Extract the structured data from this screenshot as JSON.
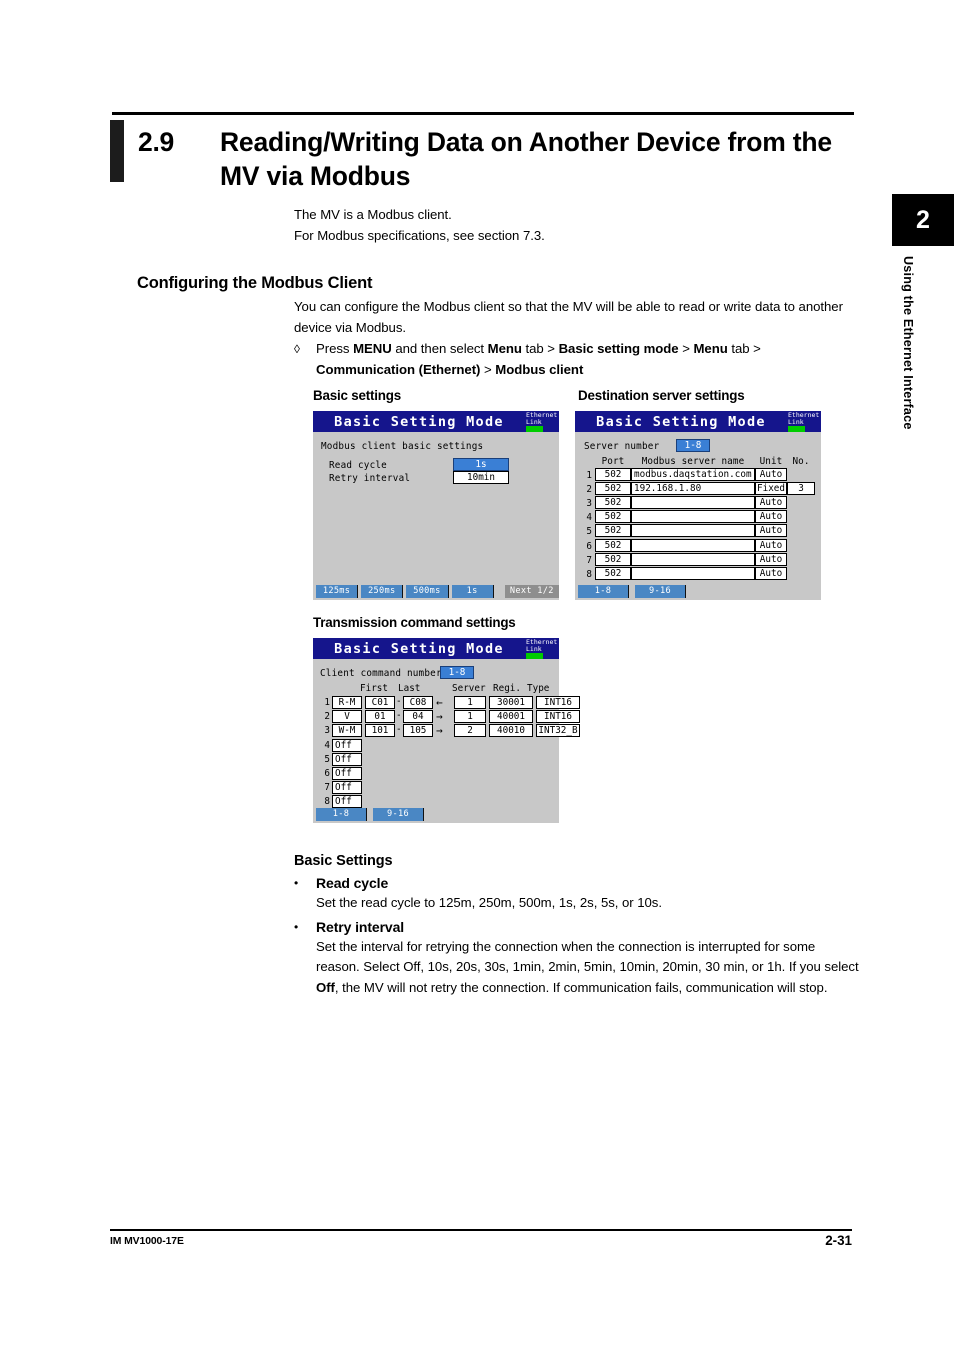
{
  "section": {
    "number": "2.9",
    "title": "Reading/Writing Data on Another Device from the MV via Modbus"
  },
  "intro": {
    "line1": "The MV is a Modbus client.",
    "line2": "For Modbus specifications, see section 7.3."
  },
  "configuring": {
    "heading": "Configuring the Modbus Client",
    "paragraph": "You can configure the Modbus client so that the MV will be able to read or write data to another device via Modbus.",
    "diamond": "◊",
    "press_prefix": "Press ",
    "menu_key": "MENU",
    "press_mid1": " and then select ",
    "menu_tab": "Menu",
    "press_mid2": " tab > ",
    "basic_setting_mode": "Basic setting mode",
    "press_mid3": " > ",
    "menu_tab2": "Menu",
    "press_mid4": " tab >",
    "comm_ethernet": "Communication (Ethernet)",
    "press_mid5": " > ",
    "modbus_client": "Modbus client"
  },
  "figures": {
    "basic_caption": "Basic settings",
    "dest_caption": "Destination server settings",
    "trans_caption": "Transmission command settings"
  },
  "lcd_common": {
    "title": "Basic Setting Mode",
    "eth_line1": "Ethernet",
    "eth_line2": "Link"
  },
  "lcd_basic": {
    "header": "Modbus client basic settings",
    "label_read_cycle": "Read cycle",
    "value_read_cycle": "1s",
    "label_retry_interval": "Retry interval",
    "value_retry_interval": "10min",
    "softkeys": [
      "125ms",
      "250ms",
      "500ms",
      "1s"
    ],
    "next_key": "Next 1/2"
  },
  "lcd_dest": {
    "label_server_number": "Server number",
    "value_server_number": "1-8",
    "columns": [
      "Port",
      "Modbus server name",
      "Unit",
      "No."
    ],
    "rows": [
      {
        "index": "1",
        "port": "502",
        "name": "modbus.daqstation.com",
        "unit": "Auto",
        "no": ""
      },
      {
        "index": "2",
        "port": "502",
        "name": "192.168.1.80",
        "unit": "Fixed",
        "no": "3"
      },
      {
        "index": "3",
        "port": "502",
        "name": "",
        "unit": "Auto",
        "no": ""
      },
      {
        "index": "4",
        "port": "502",
        "name": "",
        "unit": "Auto",
        "no": ""
      },
      {
        "index": "5",
        "port": "502",
        "name": "",
        "unit": "Auto",
        "no": ""
      },
      {
        "index": "6",
        "port": "502",
        "name": "",
        "unit": "Auto",
        "no": ""
      },
      {
        "index": "7",
        "port": "502",
        "name": "",
        "unit": "Auto",
        "no": ""
      },
      {
        "index": "8",
        "port": "502",
        "name": "",
        "unit": "Auto",
        "no": ""
      }
    ],
    "tabs": [
      "1-8",
      "9-16"
    ]
  },
  "lcd_trans": {
    "label_command_number": "Client command number",
    "value_command_number": "1-8",
    "columns": [
      "First",
      "Last",
      "Server",
      "Regi.",
      "Type"
    ],
    "rows": [
      {
        "index": "1",
        "mode": "R-M",
        "first": "C01",
        "dash": "-",
        "last": "C08",
        "arrow": "←",
        "server": "1",
        "regi": "30001",
        "type": "INT16"
      },
      {
        "index": "2",
        "mode": "V",
        "first": "01",
        "dash": "-",
        "last": "04",
        "arrow": "→",
        "server": "1",
        "regi": "40001",
        "type": "INT16"
      },
      {
        "index": "3",
        "mode": "W-M",
        "first": "101",
        "dash": "-",
        "last": "105",
        "arrow": "→",
        "server": "2",
        "regi": "40010",
        "type": "INT32_B"
      },
      {
        "index": "4",
        "mode": "Off",
        "first": "",
        "dash": "",
        "last": "",
        "arrow": "",
        "server": "",
        "regi": "",
        "type": ""
      },
      {
        "index": "5",
        "mode": "Off",
        "first": "",
        "dash": "",
        "last": "",
        "arrow": "",
        "server": "",
        "regi": "",
        "type": ""
      },
      {
        "index": "6",
        "mode": "Off",
        "first": "",
        "dash": "",
        "last": "",
        "arrow": "",
        "server": "",
        "regi": "",
        "type": ""
      },
      {
        "index": "7",
        "mode": "Off",
        "first": "",
        "dash": "",
        "last": "",
        "arrow": "",
        "server": "",
        "regi": "",
        "type": ""
      },
      {
        "index": "8",
        "mode": "Off",
        "first": "",
        "dash": "",
        "last": "",
        "arrow": "",
        "server": "",
        "regi": "",
        "type": ""
      }
    ],
    "tabs": [
      "1-8",
      "9-16"
    ]
  },
  "basic_settings": {
    "title": "Basic Settings",
    "bullet": "•",
    "items": [
      {
        "label": "Read cycle",
        "body": "Set the read cycle to 125m, 250m, 500m, 1s, 2s, 5s, or 10s."
      },
      {
        "label": "Retry interval",
        "body_part1": "Set the interval for retrying the connection when the connection is interrupted for some reason. Select Off, 10s, 20s, 30s, 1min, 2min, 5min, 10min, 20min, 30 min, or 1h. If you select ",
        "body_bold": "Off",
        "body_part2": ", the MV will not retry the connection. If communication fails, communication will stop."
      }
    ]
  },
  "side_tab": {
    "chapter": "2",
    "label": "Using the Ethernet Interface"
  },
  "footer": {
    "manual_id": "IM MV1000-17E",
    "page": "2-31"
  },
  "colors": {
    "lcd_title_bg": "#15158c",
    "lcd_bg": "#c8c8c8",
    "selected_field": "#3a7fd5",
    "softkey": "#4a87c4",
    "led_green": "#00cc00"
  }
}
